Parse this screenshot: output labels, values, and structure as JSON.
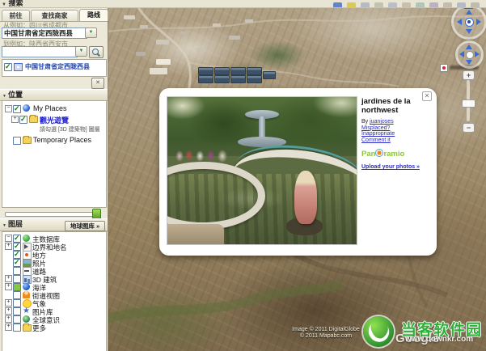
{
  "search_panel": {
    "header": "搜索",
    "tabs": [
      {
        "label": "前往"
      },
      {
        "label": "查找商家"
      },
      {
        "label": "路线"
      }
    ],
    "active_tab": "路线",
    "from_hint": "从例如：四川省成都市",
    "from_value": "中国甘肃省定西陇西县",
    "to_hint": "到例如：陕西省西安市",
    "to_value": "",
    "result_label": "中国甘肃省定西陇西县",
    "close_button": "✕"
  },
  "places_panel": {
    "header": "位置",
    "my_places": "My Places",
    "sightseeing": "觀光遊覽",
    "note": "請勾選 [3D 建築物] 圖層",
    "temporary": "Temporary Places"
  },
  "layers_panel": {
    "header": "图层",
    "gallery_button": "地球图库 »",
    "items": [
      {
        "label": "主数据库",
        "checked": true
      },
      {
        "label": "边界和地名",
        "checked": true
      },
      {
        "label": "地方",
        "checked": true
      },
      {
        "label": "照片",
        "checked": true
      },
      {
        "label": "道路",
        "checked": false
      },
      {
        "label": "3D 建筑",
        "checked": false
      },
      {
        "label": "海洋",
        "checked": true
      },
      {
        "label": "街道视图",
        "checked": false
      },
      {
        "label": "气象",
        "checked": false
      },
      {
        "label": "图片库",
        "checked": false
      },
      {
        "label": "全球意识",
        "checked": false
      },
      {
        "label": "更多",
        "checked": false
      }
    ]
  },
  "photo_popup": {
    "title": "jardines de la northwest",
    "by_label": "By",
    "author": "juanjoses",
    "link_misplaced": "Misplaced?",
    "link_inappropriate": "Inappropriate",
    "link_comment": "Comment it",
    "logo_pan": "Pan",
    "logo_ramio": "ramio",
    "upload_link": "Upload your photos »",
    "close_button": "✕"
  },
  "map": {
    "copyright_line1": "Image © 2011 DigitalGlobe",
    "copyright_line2": "© 2011 Mapabc.com",
    "google_logo": "Google",
    "compass_north": "N",
    "zoom_in": "+",
    "zoom_out": "−"
  },
  "watermark": {
    "site_name": "当客软件园",
    "site_url": "www.downkr.com"
  }
}
